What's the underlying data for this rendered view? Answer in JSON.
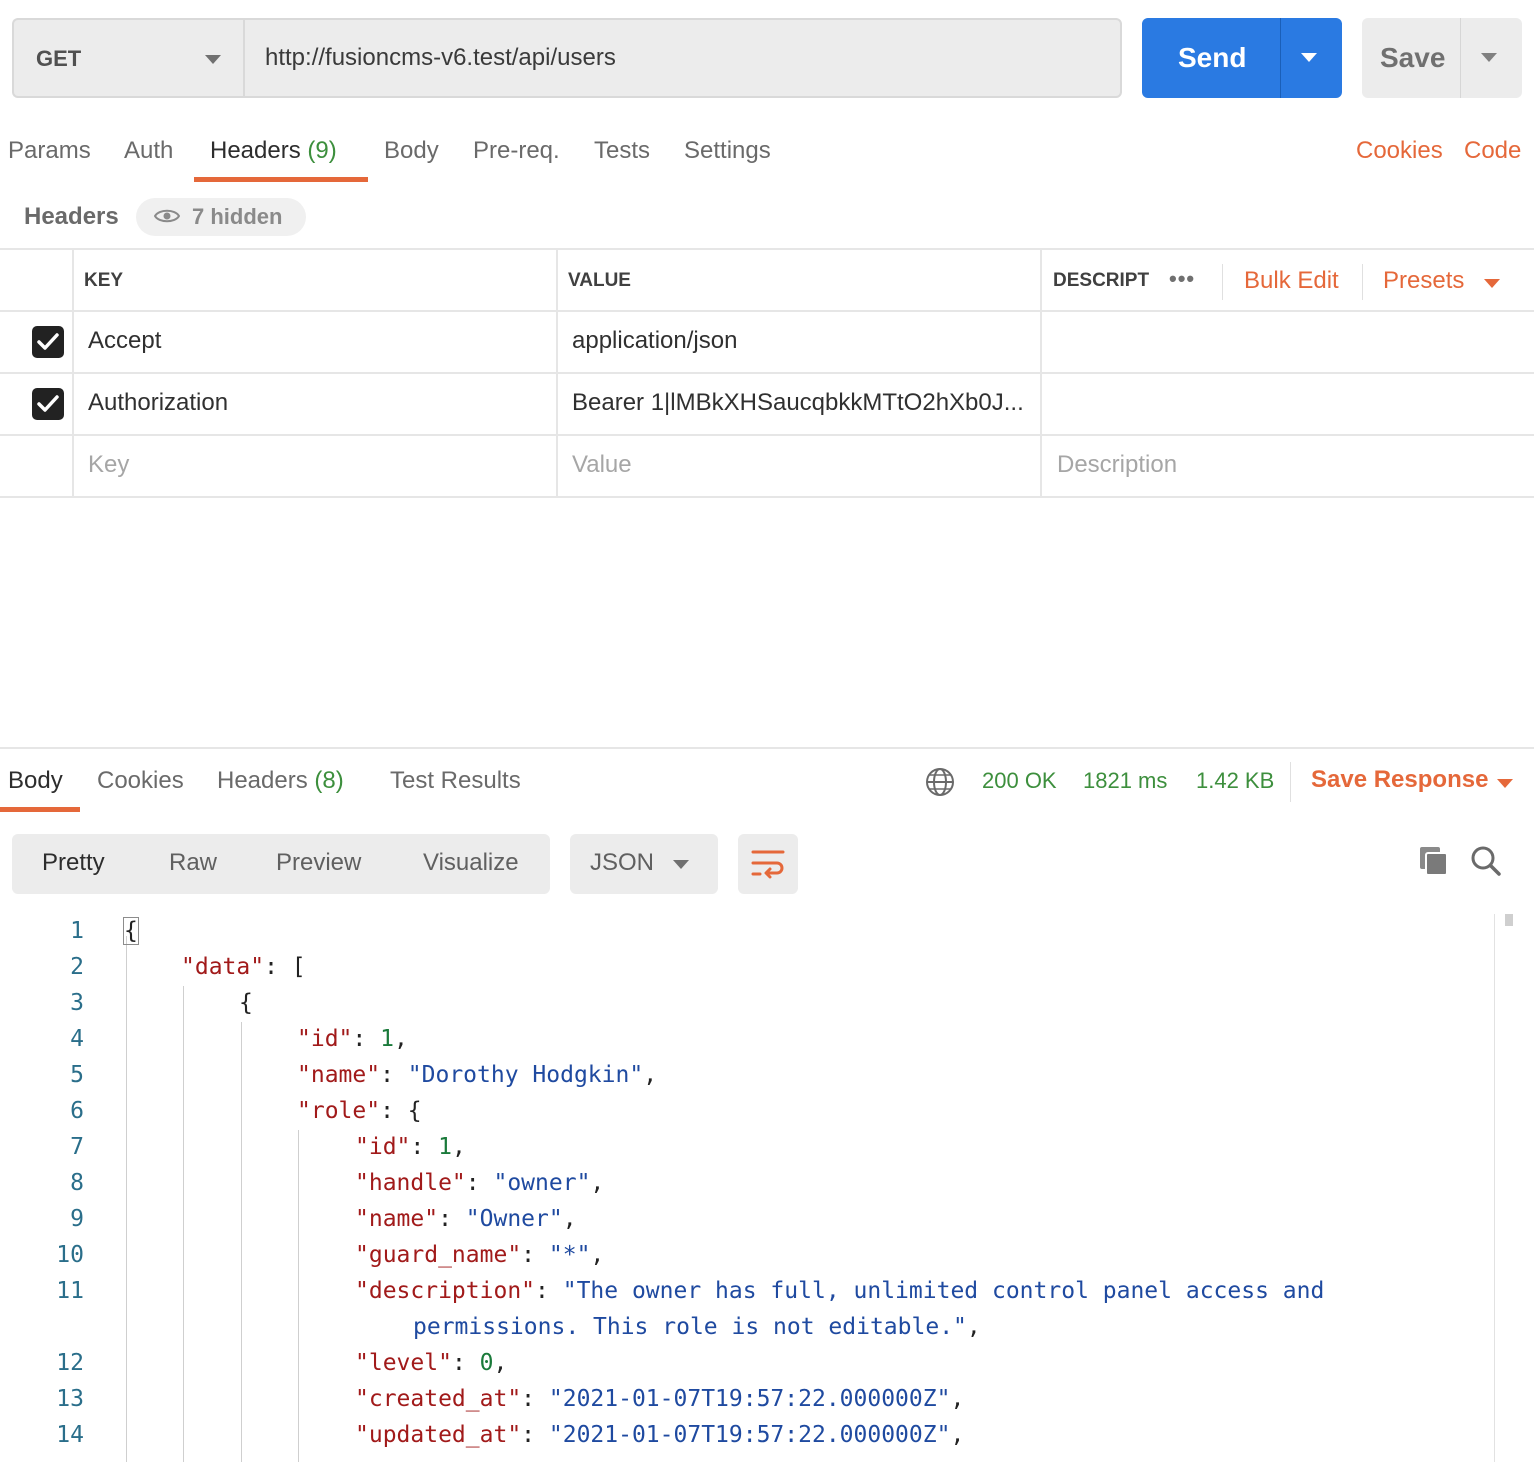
{
  "request": {
    "method": "GET",
    "url": "http://fusioncms-v6.test/api/users",
    "send_label": "Send",
    "save_label": "Save"
  },
  "request_tabs": {
    "params": "Params",
    "auth": "Auth",
    "headers": "Headers",
    "headers_count": "(9)",
    "body": "Body",
    "prereq": "Pre-req.",
    "tests": "Tests",
    "settings": "Settings",
    "cookies": "Cookies",
    "code": "Code"
  },
  "headers_section": {
    "title": "Headers",
    "hidden_label": "7 hidden"
  },
  "headers_table": {
    "columns": {
      "key": "KEY",
      "value": "VALUE",
      "description": "DESCRIPT"
    },
    "more_label": "•••",
    "bulk_edit": "Bulk Edit",
    "presets": "Presets",
    "rows": [
      {
        "checked": true,
        "key": "Accept",
        "value": "application/json"
      },
      {
        "checked": true,
        "key": "Authorization",
        "value": "Bearer 1|lMBkXHSaucqbkkMTtO2hXb0J..."
      }
    ],
    "placeholder": {
      "key": "Key",
      "value": "Value",
      "description": "Description"
    }
  },
  "response_tabs": {
    "body": "Body",
    "cookies": "Cookies",
    "headers": "Headers",
    "headers_count": "(8)",
    "test_results": "Test Results"
  },
  "response_status": {
    "status": "200 OK",
    "time": "1821 ms",
    "size": "1.42 KB",
    "save_response": "Save Response"
  },
  "format_bar": {
    "pretty": "Pretty",
    "raw": "Raw",
    "preview": "Preview",
    "visualize": "Visualize",
    "language": "JSON"
  },
  "code_lines": {
    "l1": "1",
    "l2": "2",
    "l3": "3",
    "l4": "4",
    "l5": "5",
    "l6": "6",
    "l7": "7",
    "l8": "8",
    "l9": "9",
    "l10": "10",
    "l11": "11",
    "l12": "12",
    "l13": "13",
    "l14": "14",
    "brace_open": "{",
    "data_key": "\"data\"",
    "data_rest": ": [",
    "id_key": "\"id\"",
    "id_val": "1",
    "name_key": "\"name\"",
    "name_val": "\"Dorothy Hodgkin\"",
    "role_key": "\"role\"",
    "role_rest": ": {",
    "role_id_key": "\"id\"",
    "role_id_val": "1",
    "handle_key": "\"handle\"",
    "handle_val": "\"owner\"",
    "rname_key": "\"name\"",
    "rname_val": "\"Owner\"",
    "guard_key": "\"guard_name\"",
    "guard_val": "\"*\"",
    "desc_key": "\"description\"",
    "desc_val_1": "\"The owner has full, unlimited control panel access and",
    "desc_val_2": "permissions. This role is not editable.\"",
    "level_key": "\"level\"",
    "level_val": "0",
    "created_key": "\"created_at\"",
    "created_val": "\"2021-01-07T19:57:22.000000Z\"",
    "updated_key": "\"updated_at\"",
    "updated_val": "\"2021-01-07T19:57:22.000000Z\""
  },
  "colors": {
    "send_blue": "#2a7ae2",
    "accent_orange": "#e5683a",
    "status_green": "#3d8f3d",
    "json_key": "#a11a1a",
    "json_string": "#1f4aa0",
    "json_number": "#1a7a3a"
  }
}
